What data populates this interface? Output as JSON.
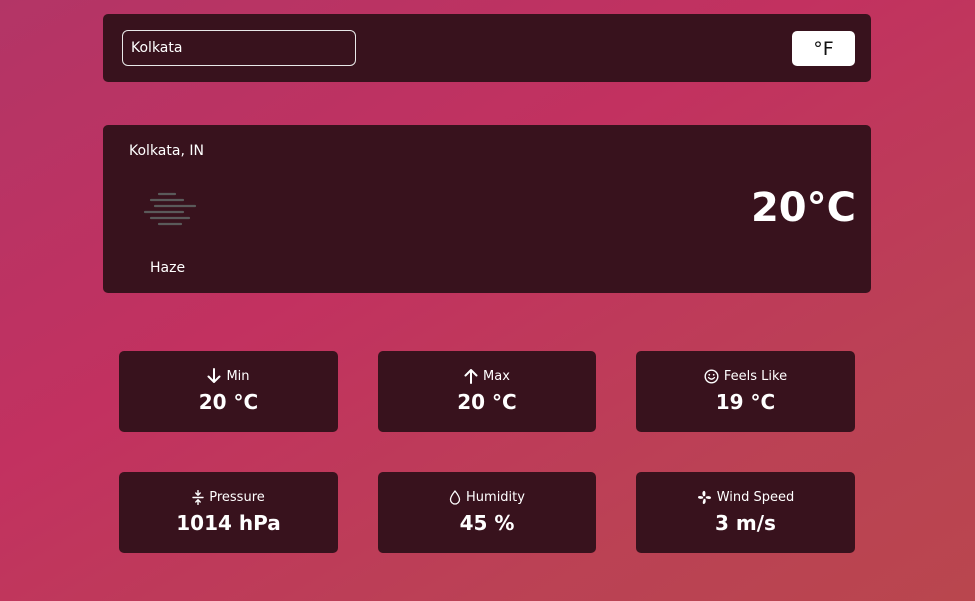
{
  "search": {
    "value": "Kolkata"
  },
  "unit_toggle": {
    "label": "°F"
  },
  "current": {
    "location": "Kolkata, IN",
    "condition": "Haze",
    "condition_icon": "haze-icon",
    "temperature": "20°C"
  },
  "stats": {
    "min": {
      "label": "Min",
      "value": "20 °C",
      "icon": "arrow-down-icon"
    },
    "max": {
      "label": "Max",
      "value": "20 °C",
      "icon": "arrow-up-icon"
    },
    "feels_like": {
      "label": "Feels Like",
      "value": "19 °C",
      "icon": "smiley-icon"
    },
    "pressure": {
      "label": "Pressure",
      "value": "1014 hPa",
      "icon": "compress-icon"
    },
    "humidity": {
      "label": "Humidity",
      "value": "45 %",
      "icon": "droplet-icon"
    },
    "wind_speed": {
      "label": "Wind Speed",
      "value": "3 m/s",
      "icon": "fan-icon"
    }
  },
  "colors": {
    "panel": "#38121d",
    "background_start": "#b33566",
    "background_end": "#b9464e",
    "text": "#ffffff"
  }
}
